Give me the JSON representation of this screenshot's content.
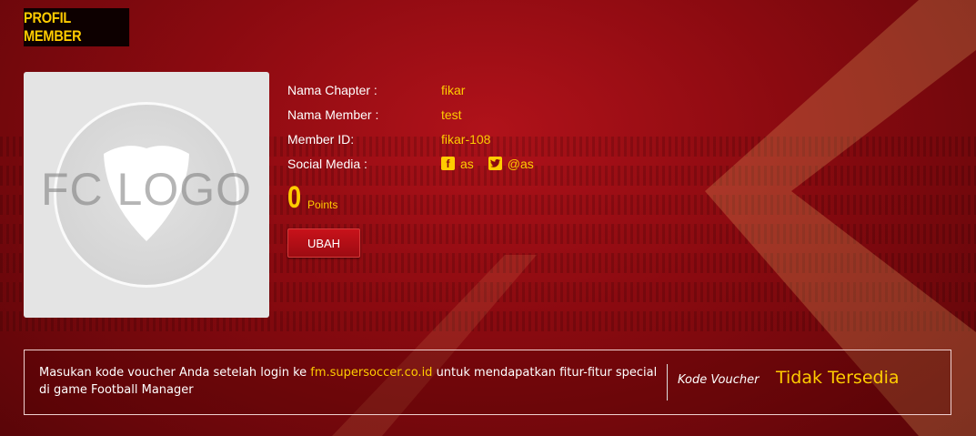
{
  "section": {
    "title": "PROFIL MEMBER"
  },
  "logo": {
    "placeholder_text": "FC LOGO"
  },
  "profile": {
    "rows": [
      {
        "label": "Nama Chapter :",
        "value": "fikar"
      },
      {
        "label": "Nama Member :",
        "value": "test"
      },
      {
        "label": "Member ID:",
        "value": "fikar-108"
      }
    ],
    "social_label": "Social Media :",
    "facebook_icon": "facebook-icon",
    "facebook_handle": "as",
    "twitter_icon": "twitter-icon",
    "twitter_handle": "@as"
  },
  "points": {
    "value": "0",
    "label": "Points"
  },
  "buttons": {
    "edit_label": "UBAH"
  },
  "voucher": {
    "text_before": "Masukan kode voucher Anda setelah login ke ",
    "link": "fm.supersoccer.co.id",
    "text_after": " untuk mendapatkan fitur-fitur special di game Football Manager",
    "label": "Kode Voucher",
    "value": "Tidak Tersedia"
  },
  "colors": {
    "accent": "#ffcc00",
    "background": "#8a0a10",
    "button": "#b0121a"
  }
}
